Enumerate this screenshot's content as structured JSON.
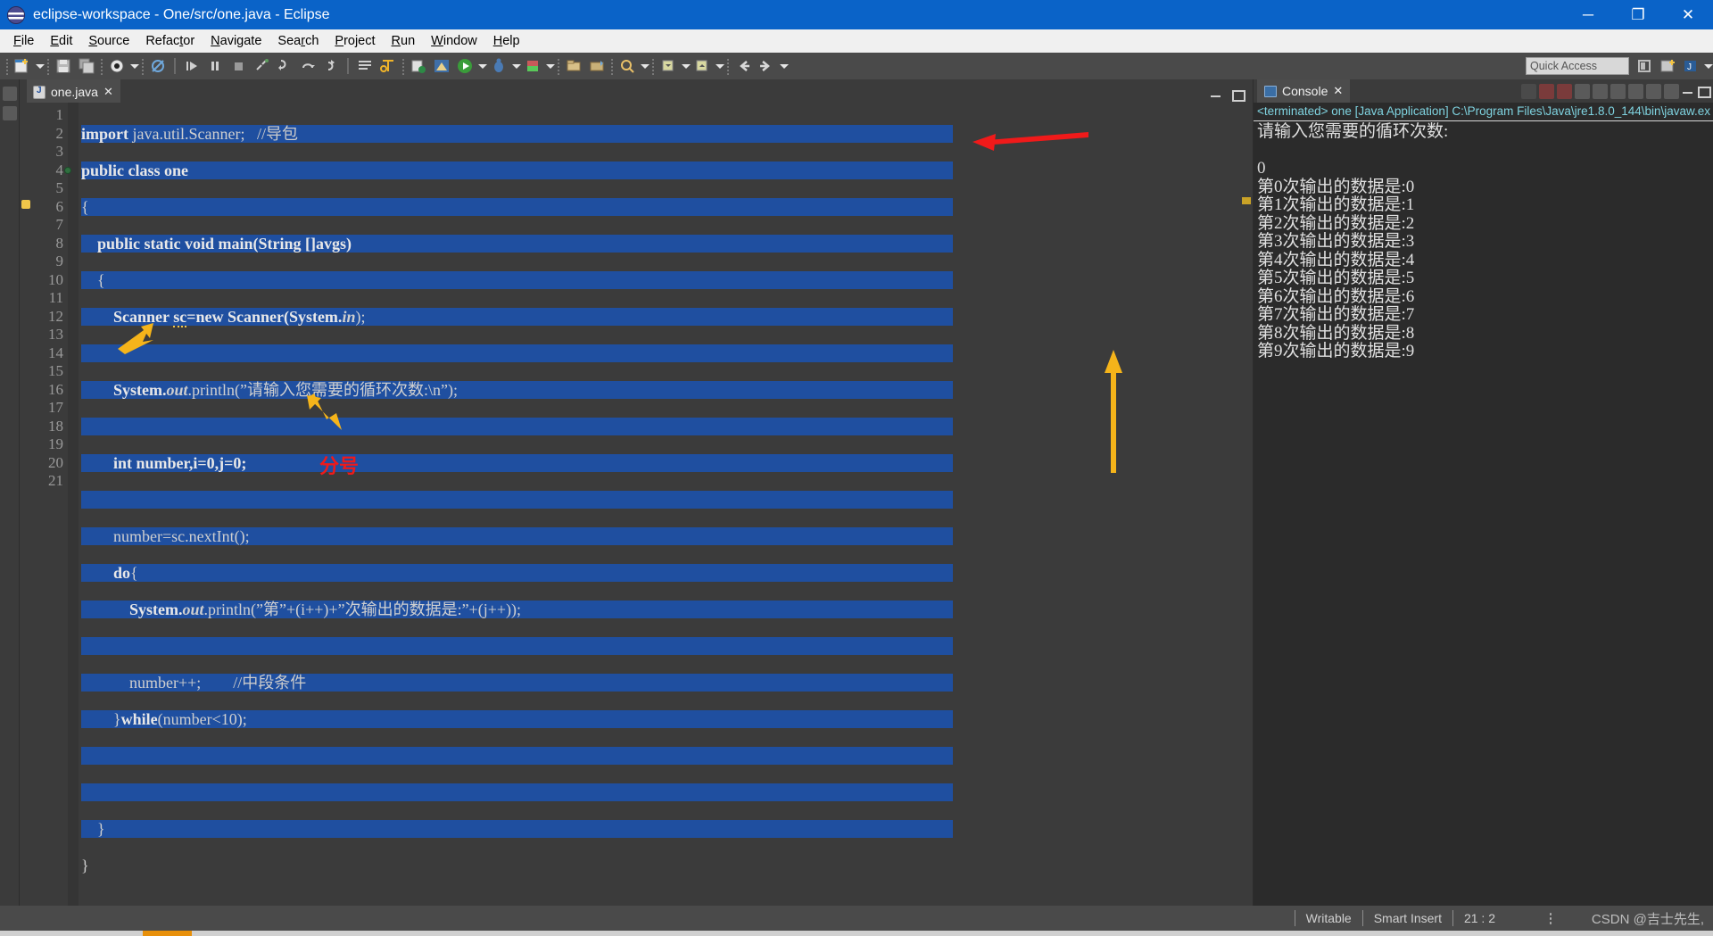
{
  "window": {
    "title": "eclipse-workspace - One/src/one.java - Eclipse",
    "logo_icon": "eclipse-logo-icon",
    "minimize_label": "─",
    "maximize_label": "❐",
    "close_label": "✕"
  },
  "menubar": {
    "items": [
      {
        "label": "File",
        "mnemonic": "F"
      },
      {
        "label": "Edit",
        "mnemonic": "E"
      },
      {
        "label": "Source",
        "mnemonic": "S"
      },
      {
        "label": "Refactor",
        "mnemonic": "t"
      },
      {
        "label": "Navigate",
        "mnemonic": "N"
      },
      {
        "label": "Search",
        "mnemonic": "r"
      },
      {
        "label": "Project",
        "mnemonic": "P"
      },
      {
        "label": "Run",
        "mnemonic": "R"
      },
      {
        "label": "Window",
        "mnemonic": "W"
      },
      {
        "label": "Help",
        "mnemonic": "H"
      }
    ]
  },
  "toolbar": {
    "quick_access_placeholder": "Quick Access",
    "icons": [
      "new-wizard-icon",
      "new-dropdown-caret-icon",
      "save-icon",
      "save-all-icon",
      "debug-perspective-icon",
      "debug-dropdown-caret-icon",
      "skip-breakpoints-icon",
      "resume-icon",
      "suspend-icon",
      "terminate-icon",
      "disconnect-icon",
      "step-into-icon",
      "step-over-icon",
      "step-return-icon",
      "toggle-console-icon",
      "external-tools-icon",
      "new-java-class-icon",
      "new-java-project-icon",
      "run-icon",
      "run-dropdown-caret-icon",
      "debug-run-icon",
      "debug-run-dropdown-caret-icon",
      "coverage-icon",
      "coverage-dropdown-caret-icon",
      "external-tools-run-icon",
      "external-tools-dropdown-caret-icon",
      "new-package-icon",
      "open-type-icon",
      "search-icon",
      "search-dropdown-caret-icon",
      "next-annotation-icon",
      "next-dropdown-caret-icon",
      "prev-annotation-icon",
      "prev-dropdown-caret-icon",
      "back-icon",
      "forward-icon",
      "forward-dropdown-caret-icon"
    ],
    "right_icons": [
      "pin-editor-icon",
      "open-perspective-icon",
      "java-perspective-icon",
      "perspective-caret-icon"
    ]
  },
  "editor": {
    "tab": {
      "label": "one.java",
      "file_icon": "java-file-icon",
      "close_label": "✕"
    },
    "view_buttons": [
      "minimize-view-button",
      "maximize-view-button"
    ],
    "lines": [
      {
        "n": 1,
        "breakpoint": false
      },
      {
        "n": 2,
        "breakpoint": false
      },
      {
        "n": 3,
        "breakpoint": false
      },
      {
        "n": 4,
        "breakpoint": true
      },
      {
        "n": 5,
        "breakpoint": false
      },
      {
        "n": 6,
        "breakpoint": false
      },
      {
        "n": 7,
        "breakpoint": false
      },
      {
        "n": 8,
        "breakpoint": false
      },
      {
        "n": 9,
        "breakpoint": false
      },
      {
        "n": 10,
        "breakpoint": false
      },
      {
        "n": 11,
        "breakpoint": false
      },
      {
        "n": 12,
        "breakpoint": false
      },
      {
        "n": 13,
        "breakpoint": false
      },
      {
        "n": 14,
        "breakpoint": false
      },
      {
        "n": 15,
        "breakpoint": false
      },
      {
        "n": 16,
        "breakpoint": false
      },
      {
        "n": 17,
        "breakpoint": false
      },
      {
        "n": 18,
        "breakpoint": false
      },
      {
        "n": 19,
        "breakpoint": false
      },
      {
        "n": 20,
        "breakpoint": false
      },
      {
        "n": 21,
        "breakpoint": false
      }
    ],
    "code": {
      "l1_kw": "import",
      "l1_rest": " java.util.Scanner;",
      "l1_comment": "//导包",
      "l2": "public class one",
      "l3": "{",
      "l4": "    public static void main(String []avgs)",
      "l5": "    {",
      "l6_a": "        Scanner ",
      "l6_warn": "sc",
      "l6_b": "=new Scanner(System.",
      "l6_ital": "in",
      "l6_c": ");",
      "l7": "",
      "l8_a": "        System.",
      "l8_ital": "out",
      "l8_b": ".println(”请输入您需要的循环次数:\\n”);",
      "l9": "",
      "l10": "        int number,i=0,j=0;",
      "l11": "",
      "l12": "        number=sc.nextInt();",
      "l13_kw": "        do",
      "l13_rest": "{",
      "l14_a": "            System.",
      "l14_ital": "out",
      "l14_b": ".println(”第”+(i++)+”次输出的数据是:”+(j++));",
      "l15": "",
      "l16_a": "            number++;",
      "l16_cmt": "        //中段条件",
      "l17_a": "        }",
      "l17_kw": "while",
      "l17_b": "(number<10);",
      "l18": "",
      "l19": "",
      "l20": "    }",
      "l21": "}"
    }
  },
  "console": {
    "tab": {
      "label": "Console",
      "icon": "console-icon",
      "close_label": "✕"
    },
    "tools": [
      "terminate-icon",
      "remove-launch-icon",
      "remove-all-terminated-icon",
      "clear-console-icon",
      "scroll-lock-icon",
      "word-wrap-icon",
      "pin-console-icon",
      "display-selected-console-icon",
      "display-caret-icon",
      "open-console-icon",
      "open-caret-icon",
      "minimize-icon",
      "maximize-icon"
    ],
    "header": "<terminated> one [Java Application] C:\\Program Files\\Java\\jre1.8.0_144\\bin\\javaw.ex",
    "output_lines": [
      "请输入您需要的循环次数:",
      "",
      "0",
      "第0次输出的数据是:0",
      "第1次输出的数据是:1",
      "第2次输出的数据是:2",
      "第3次输出的数据是:3",
      "第4次输出的数据是:4",
      "第5次输出的数据是:5",
      "第6次输出的数据是:6",
      "第7次输出的数据是:7",
      "第8次输出的数据是:8",
      "第9次输出的数据是:9"
    ]
  },
  "annotations": {
    "red_label": "分号",
    "arrows": [
      "yellow-arrow-do-brace",
      "yellow-arrow-semicolon",
      "red-arrow-console-input",
      "yellow-arrow-console-output"
    ],
    "colors": {
      "red": "#f01a1a",
      "yellow": "#f5b41a"
    }
  },
  "statusbar": {
    "writable": "Writable",
    "insert_mode": "Smart Insert",
    "position": "21 : 2",
    "watermark": "CSDN @吉士先生,"
  }
}
